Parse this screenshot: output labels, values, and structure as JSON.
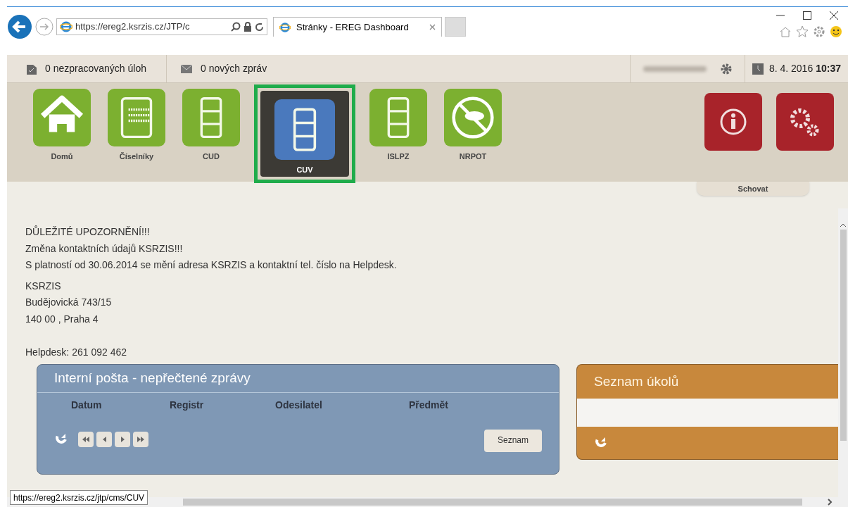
{
  "browser": {
    "address": "https://ereg2.ksrzis.cz/JTP/c",
    "tab_title": "Stránky - EREG Dashboard"
  },
  "app_bar": {
    "tasks": "0 nezpracovaných úloh",
    "messages": "0 nových zpráv",
    "date": "8. 4. 2016",
    "time": "10:37"
  },
  "modules": [
    {
      "label": "Domů",
      "kind": "home",
      "selected": false
    },
    {
      "label": "Číselníky",
      "kind": "numbers",
      "selected": false
    },
    {
      "label": "CUD",
      "kind": "list",
      "selected": false
    },
    {
      "label": "CUV",
      "kind": "list",
      "selected": true
    },
    {
      "label": "ISLPZ",
      "kind": "list",
      "selected": false
    },
    {
      "label": "NRPOT",
      "kind": "forbidden",
      "selected": false
    }
  ],
  "hide_tab": "Schovat",
  "notice": [
    "DŮLEŽITÉ UPOZORNĚNÍ!!!",
    "Změna kontaktních údajů KSRZIS!!!",
    "S platností od 30.06.2014 se mění adresa KSRZIS a kontaktní tel. číslo na Helpdesk."
  ],
  "address": [
    "KSRZIS",
    "Budějovická 743/15",
    "140 00 , Praha 4"
  ],
  "helpdesk": "Helpdesk: 261 092 462",
  "mail_panel": {
    "title": "Interní pošta - nepřečtené zprávy",
    "columns": [
      "Datum",
      "Registr",
      "Odesilatel",
      "Předmět"
    ],
    "button": "Seznam"
  },
  "tasks_panel": {
    "title": "Seznam úkolů"
  },
  "status_url": "https://ereg2.ksrzis.cz/jtp/cms/CUV"
}
